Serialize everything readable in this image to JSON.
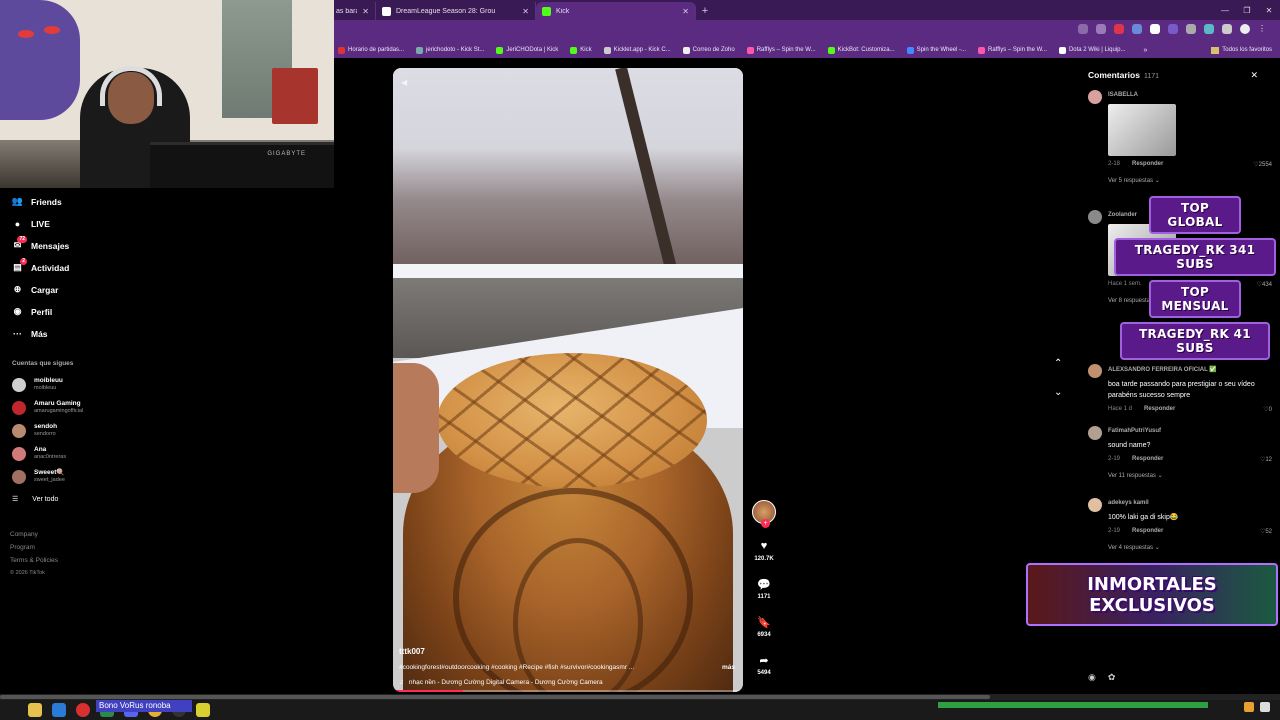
{
  "browser": {
    "tabs": [
      {
        "title": "as barat",
        "active": false,
        "favicon_color": "#8899aa"
      },
      {
        "title": "DreamLeague Season 28: Grou",
        "active": false,
        "favicon_color": "#ffffff"
      },
      {
        "title": "Kick",
        "active": true,
        "favicon_color": "#53fc18"
      }
    ],
    "new_tab_label": "+",
    "bookmarks": [
      {
        "label": "Horario de partidas...",
        "icon_color": "#d33"
      },
      {
        "label": "jerichodoto - Kick St...",
        "icon_color": "#7aa"
      },
      {
        "label": "JeriCHODota | Kick",
        "icon_color": "#53fc18"
      },
      {
        "label": "Kick",
        "icon_color": "#53fc18"
      },
      {
        "label": "Kicklet.app - Kick C...",
        "icon_color": "#ccc"
      },
      {
        "label": "Correo de Zoho",
        "icon_color": "#eee"
      },
      {
        "label": "Rafflys – Spin the W...",
        "icon_color": "#f5a"
      },
      {
        "label": "KickBot: Customiza...",
        "icon_color": "#53fc18"
      },
      {
        "label": "Spin the Wheel -...",
        "icon_color": "#48f"
      },
      {
        "label": "Rafflys – Spin the W...",
        "icon_color": "#f5a"
      },
      {
        "label": "Dota 2 Wiki | Liquip...",
        "icon_color": "#fff"
      }
    ],
    "bookmarks_more": "»",
    "all_bookmarks": "Todos los favoritos"
  },
  "webcam": {
    "monitor_label": "GIGABYTE"
  },
  "sidebar": {
    "nav": [
      {
        "label": "Friends",
        "icon": "friends-icon",
        "glyph": "👥",
        "badge": ""
      },
      {
        "label": "LIVE",
        "icon": "live-icon",
        "glyph": "●",
        "badge": ""
      },
      {
        "label": "Mensajes",
        "icon": "messages-icon",
        "glyph": "✉",
        "badge": "72"
      },
      {
        "label": "Actividad",
        "icon": "activity-icon",
        "glyph": "▤",
        "badge": "2"
      },
      {
        "label": "Cargar",
        "icon": "upload-icon",
        "glyph": "⊕",
        "badge": ""
      },
      {
        "label": "Perfil",
        "icon": "profile-icon",
        "glyph": "◉",
        "badge": ""
      },
      {
        "label": "Más",
        "icon": "more-icon",
        "glyph": "···",
        "badge": ""
      }
    ],
    "following_title": "Cuentas que sigues",
    "following": [
      {
        "name": "moibleuu",
        "handle": "moibleuu",
        "avatar_color": "#cfcfcf"
      },
      {
        "name": "Amaru Gaming",
        "handle": "amarugamingofficial",
        "avatar_color": "#c0272d"
      },
      {
        "name": "sendoh",
        "handle": "sendorro",
        "avatar_color": "#b88a70"
      },
      {
        "name": "Ana",
        "handle": "anac0ntreras",
        "avatar_color": "#d07a7a"
      },
      {
        "name": "Sweeet🍭",
        "handle": "sweet_jadee",
        "avatar_color": "#a07060"
      }
    ],
    "see_all": "Ver todo",
    "footer": [
      "Company",
      "Program",
      "Terms & Policies"
    ],
    "copyright": "© 2026 TikTok"
  },
  "video": {
    "author": "tttk007",
    "hashtags": "#cookingforest#outdoorcooking #cooking #Recipe #fish  #survivor#cookingasmr ...",
    "more_label": "más",
    "music": "nhạc nền - Dương Cường Digital Camera - Dương Cường Camera",
    "progress": 0.2
  },
  "actions": {
    "likes": "120.7K",
    "comments": "1171",
    "saves": "6934",
    "shares": "5494"
  },
  "comments": {
    "title": "Comentarios",
    "count": "1171",
    "items": [
      {
        "user": "ISABELLA",
        "text": "",
        "has_image": true,
        "date": "2-18",
        "reply": "Responder",
        "likes": "2554",
        "more": "Ver 5 respuestas ⌄",
        "avatar_color": "#d9a0a0"
      },
      {
        "user": "Zoolander",
        "text": "",
        "has_image": true,
        "date": "Hace 1 sem.",
        "reply": "Responder",
        "likes": "434",
        "more": "Ver 8 respuestas ⌄",
        "avatar_color": "#8a8a8a"
      },
      {
        "user": "ALEXSANDRO FERREIRA OFICIAL ✅",
        "text": "boa tarde passando para prestigiar o seu vídeo parabéns sucesso sempre",
        "has_image": false,
        "date": "Hace 1 d",
        "reply": "Responder",
        "likes": "0",
        "more": "",
        "avatar_color": "#c09070"
      },
      {
        "user": "FatimahPutriYusuf",
        "text": "sound name?",
        "has_image": false,
        "date": "2-19",
        "reply": "Responder",
        "likes": "12",
        "more": "Ver 11 respuestas ⌄",
        "avatar_color": "#b0a090"
      },
      {
        "user": "adekeys kamil",
        "text": "100% laki ga di skip😂",
        "has_image": false,
        "date": "2-19",
        "reply": "Responder",
        "likes": "52",
        "more": "Ver 4 respuestas ⌄",
        "avatar_color": "#e0c0a0"
      }
    ]
  },
  "overlay": {
    "top_global_label": "TOP GLOBAL",
    "top_global_value": "TRAGEDY_RK 341 SUBS",
    "top_monthly_label": "TOP MENSUAL",
    "top_monthly_value": "TRAGEDY_RK 41 SUBS",
    "banner": "INMORTALES EXCLUSIVOS"
  },
  "taskbar": {
    "title": "Bono VoRus ronoba"
  }
}
